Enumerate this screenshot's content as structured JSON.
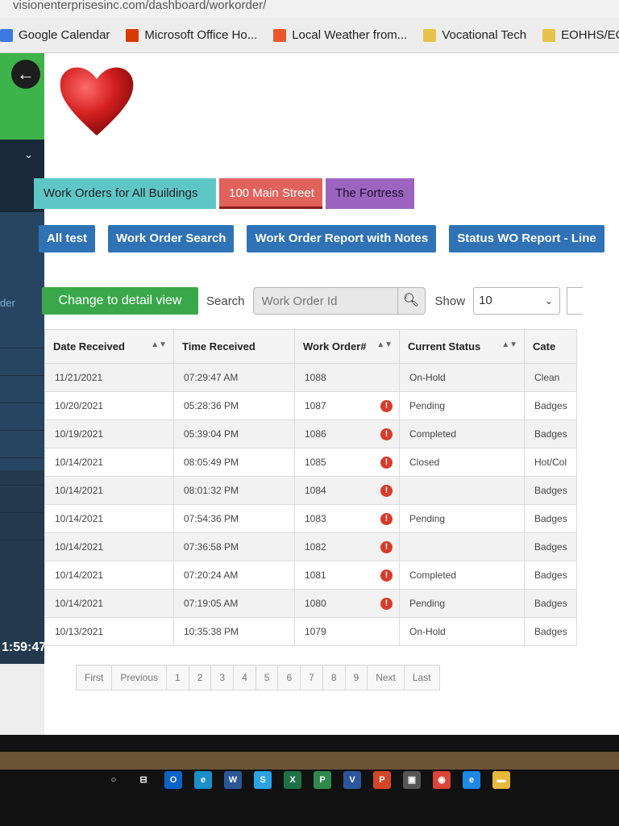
{
  "browser": {
    "url": "visionenterprisesinc.com/dashboard/workorder/",
    "bookmarks": [
      {
        "label": "Google Calendar",
        "icon": "calendar-icon",
        "color": "#3b7ae0"
      },
      {
        "label": "Microsoft Office Ho...",
        "icon": "office-icon",
        "color": "#d83b01"
      },
      {
        "label": "Local Weather from...",
        "icon": "weather-icon",
        "color": "#e8562a"
      },
      {
        "label": "Vocational Tech",
        "icon": "folder-icon",
        "color": "#e8c24a"
      },
      {
        "label": "EOHHS/EOTSS",
        "icon": "folder-icon",
        "color": "#e8c24a"
      }
    ]
  },
  "sidebar": {
    "label": "der",
    "time": "1:59:47",
    "item_chevron": "‹"
  },
  "tabs": [
    "Work Orders for All Buildings",
    "100 Main Street",
    "The Fortress"
  ],
  "buttons": [
    "All test",
    "Work Order Search",
    "Work Order Report with Notes",
    "Status WO Report - Line"
  ],
  "controls": {
    "view_toggle": "Change to detail view",
    "search_label": "Search",
    "search_placeholder": "Work Order Id",
    "show_label": "Show",
    "show_value": "10"
  },
  "table": {
    "headers": [
      "Date Received",
      "Time Received",
      "Work Order#",
      "Current Status",
      "Cate"
    ],
    "rows": [
      {
        "date": "11/21/2021",
        "time": "07:29:47 AM",
        "wo": "1088",
        "alert": false,
        "status": "On-Hold",
        "category": "Clean"
      },
      {
        "date": "10/20/2021",
        "time": "05:28:36 PM",
        "wo": "1087",
        "alert": true,
        "status": "Pending",
        "category": "Badges"
      },
      {
        "date": "10/19/2021",
        "time": "05:39:04 PM",
        "wo": "1086",
        "alert": true,
        "status": "Completed",
        "category": "Badges"
      },
      {
        "date": "10/14/2021",
        "time": "08:05:49 PM",
        "wo": "1085",
        "alert": true,
        "status": "Closed",
        "category": "Hot/Col"
      },
      {
        "date": "10/14/2021",
        "time": "08:01:32 PM",
        "wo": "1084",
        "alert": true,
        "status": "",
        "category": "Badges"
      },
      {
        "date": "10/14/2021",
        "time": "07:54:36 PM",
        "wo": "1083",
        "alert": true,
        "status": "Pending",
        "category": "Badges"
      },
      {
        "date": "10/14/2021",
        "time": "07:36:58 PM",
        "wo": "1082",
        "alert": true,
        "status": "",
        "category": "Badges"
      },
      {
        "date": "10/14/2021",
        "time": "07:20:24 AM",
        "wo": "1081",
        "alert": true,
        "status": "Completed",
        "category": "Badges"
      },
      {
        "date": "10/14/2021",
        "time": "07:19:05 AM",
        "wo": "1080",
        "alert": true,
        "status": "Pending",
        "category": "Badges"
      },
      {
        "date": "10/13/2021",
        "time": "10:35:38 PM",
        "wo": "1079",
        "alert": false,
        "status": "On-Hold",
        "category": "Badges"
      }
    ]
  },
  "pagination": [
    "First",
    "Previous",
    "1",
    "2",
    "3",
    "4",
    "5",
    "6",
    "7",
    "8",
    "9",
    "Next",
    "Last"
  ],
  "taskbar": [
    {
      "icon": "search-icon",
      "label": "○",
      "color": "transparent"
    },
    {
      "icon": "task-view-icon",
      "label": "⊟",
      "color": "transparent"
    },
    {
      "icon": "outlook-icon",
      "label": "O",
      "color": "#0a64c8"
    },
    {
      "icon": "edge-icon",
      "label": "e",
      "color": "#1a8fc9"
    },
    {
      "icon": "word-icon",
      "label": "W",
      "color": "#2b5797"
    },
    {
      "icon": "skype-icon",
      "label": "S",
      "color": "#2aa3e0"
    },
    {
      "icon": "excel-icon",
      "label": "X",
      "color": "#1e7145"
    },
    {
      "icon": "publisher-icon",
      "label": "P",
      "color": "#2f8a4d"
    },
    {
      "icon": "visio-icon",
      "label": "V",
      "color": "#2b579a"
    },
    {
      "icon": "powerpoint-icon",
      "label": "P",
      "color": "#d24726"
    },
    {
      "icon": "photos-icon",
      "label": "▣",
      "color": "#555555"
    },
    {
      "icon": "chrome-icon",
      "label": "◉",
      "color": "#db4437"
    },
    {
      "icon": "ie-icon",
      "label": "e",
      "color": "#1e88e5"
    },
    {
      "icon": "explorer-icon",
      "label": "▬",
      "color": "#e8b83a"
    }
  ]
}
